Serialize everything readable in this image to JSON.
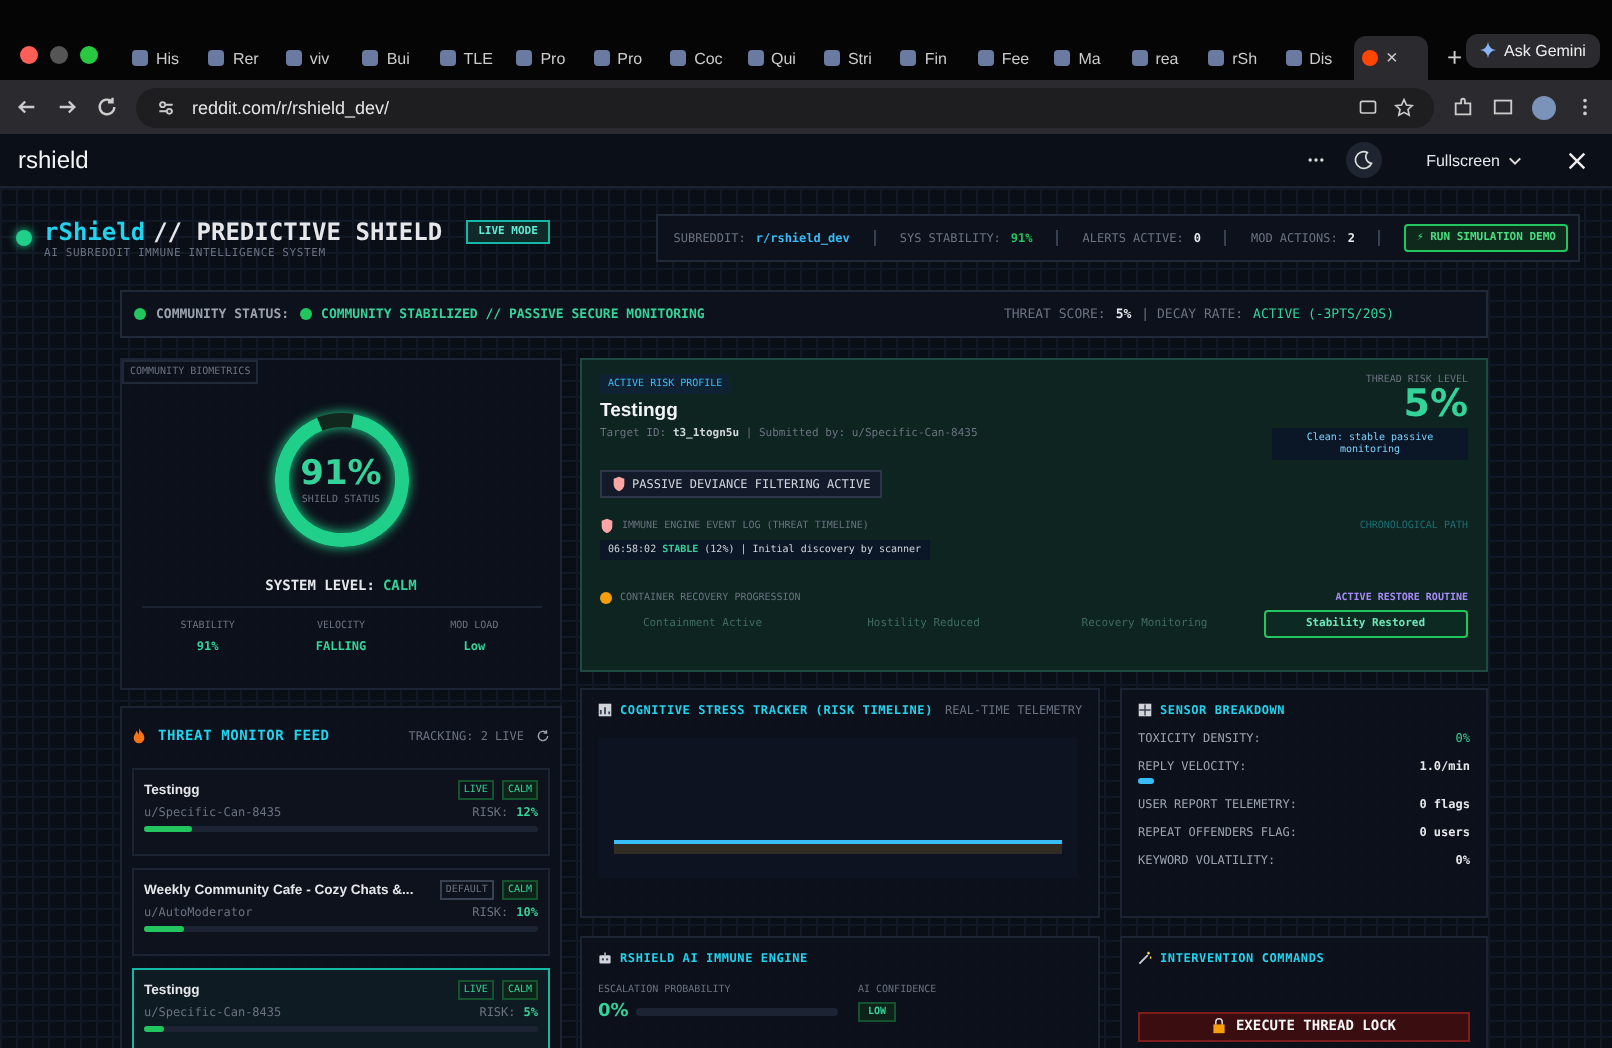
{
  "browser": {
    "tabs": [
      {
        "label": "His",
        "selected": false
      },
      {
        "label": "Rer",
        "selected": false
      },
      {
        "label": "viv",
        "selected": false
      },
      {
        "label": "Bui",
        "selected": false
      },
      {
        "label": "TLE",
        "selected": false
      },
      {
        "label": "Pro",
        "selected": false
      },
      {
        "label": "Pro",
        "selected": false
      },
      {
        "label": "Coc",
        "selected": false
      },
      {
        "label": "Qui",
        "selected": false
      },
      {
        "label": "Stri",
        "selected": false
      },
      {
        "label": "Fin",
        "selected": false
      },
      {
        "label": "Fee",
        "selected": false
      },
      {
        "label": "Ma",
        "selected": false
      },
      {
        "label": "rea",
        "selected": false
      },
      {
        "label": "rSh",
        "selected": false
      },
      {
        "label": "Dis",
        "selected": false
      },
      {
        "close": "×",
        "selected": true
      }
    ],
    "new_tab": "+",
    "gemini": "Ask Gemini",
    "url": "reddit.com/r/rshield_dev/"
  },
  "app_bar": {
    "title": "rshield",
    "fullscreen": "Fullscreen"
  },
  "header": {
    "brand": "rShield",
    "title": "// PREDICTIVE SHIELD",
    "badge": "LIVE MODE",
    "subtitle": "AI SUBREDDIT IMMUNE INTELLIGENCE SYSTEM",
    "stats": [
      {
        "label": "SUBREDDIT:",
        "value": "r/rshield_dev",
        "color": "#38bdf8"
      },
      {
        "label": "SYS STABILITY:",
        "value": "91%",
        "color": "#22c55e"
      },
      {
        "label": "ALERTS ACTIVE:",
        "value": "0",
        "color": "#e5e7eb"
      },
      {
        "label": "MOD ACTIONS:",
        "value": "2",
        "color": "#e5e7eb"
      }
    ],
    "demo_button": "⚡ RUN SIMULATION DEMO"
  },
  "status": {
    "label": "COMMUNITY STATUS:",
    "message": "COMMUNITY STABILIZED // PASSIVE SECURE MONITORING",
    "threat_label": "THREAT SCORE:",
    "threat_value": "5%",
    "decay_label": "| DECAY RATE:",
    "decay_value": "ACTIVE (-3PTS/20S)"
  },
  "biometrics": {
    "label": "COMMUNITY BIOMETRICS",
    "value": "91%",
    "caption": "SHIELD STATUS",
    "level": 0.91,
    "system_label": "SYSTEM LEVEL:",
    "system_value": "CALM",
    "stats": [
      {
        "label": "STABILITY",
        "value": "91%"
      },
      {
        "label": "VELOCITY",
        "value": "FALLING"
      },
      {
        "label": "MOD LOAD",
        "value": "Low"
      }
    ]
  },
  "risk_profile": {
    "label": "ACTIVE RISK PROFILE",
    "title": "Testingg",
    "target": "Target ID: **t3_1togn5u** | Submitted by: u/Specific-Can-8435",
    "risk_label": "THREAD RISK LEVEL",
    "risk_value": "5%",
    "risk_note": "Clean: stable passive monitoring",
    "filter": "PASSIVE DEVIANCE FILTERING ACTIVE",
    "log_title": "IMMUNE ENGINE EVENT LOG (THREAT TIMELINE)",
    "log_path": "CHRONOLOGICAL PATH",
    "events": [
      "06:58:02 **STABLE** (12%) | Initial discovery by scanner"
    ],
    "recovery_title": "CONTAINER RECOVERY PROGRESSION",
    "recovery_note": "ACTIVE RESTORE ROUTINE",
    "stages": [
      {
        "label": "Containment Active",
        "selected": false
      },
      {
        "label": "Hostility Reduced",
        "selected": false
      },
      {
        "label": "Recovery Monitoring",
        "selected": false
      },
      {
        "label": "Stability Restored",
        "selected": true
      }
    ]
  },
  "feed": {
    "title": "THREAT MONITOR FEED",
    "tracking": "TRACKING: 2 LIVE",
    "items": [
      {
        "title": "Testingg",
        "author": "u/Specific-Can-8435",
        "tags": [
          {
            "label": "LIVE",
            "kind": "live"
          },
          {
            "label": "CALM",
            "kind": "calm"
          }
        ],
        "risk_label": "RISK:",
        "risk": "12%",
        "level": 0.12,
        "selected": false
      },
      {
        "title": "Weekly Community Cafe - Cozy Chats &...",
        "author": "u/AutoModerator",
        "tags": [
          {
            "label": "DEFAULT",
            "kind": "default"
          },
          {
            "label": "CALM",
            "kind": "calm"
          }
        ],
        "risk_label": "RISK:",
        "risk": "10%",
        "level": 0.1,
        "selected": false
      },
      {
        "title": "Testingg",
        "author": "u/Specific-Can-8435",
        "tags": [
          {
            "label": "LIVE",
            "kind": "live"
          },
          {
            "label": "CALM",
            "kind": "calm"
          }
        ],
        "risk_label": "RISK:",
        "risk": "5%",
        "level": 0.05,
        "selected": true
      }
    ]
  },
  "stress_tracker": {
    "title": "COGNITIVE STRESS TRACKER (RISK TIMELINE)",
    "subtitle": "REAL-TIME TELEMETRY"
  },
  "sensors": {
    "title": "SENSOR BREAKDOWN",
    "rows": [
      {
        "label": "TOXICITY DENSITY:",
        "value": "0%",
        "kind": "good"
      },
      {
        "label": "REPLY VELOCITY:",
        "value": "1.0/min",
        "kind": "bar",
        "level": 0.05
      },
      {
        "label": "USER REPORT TELEMETRY:",
        "value": "0 flags",
        "kind": "plain"
      },
      {
        "label": "REPEAT OFFENDERS FLAG:",
        "value": "0 users",
        "kind": "plain"
      },
      {
        "label": "KEYWORD VOLATILITY:",
        "value": "0%",
        "kind": "plain"
      }
    ]
  },
  "engine": {
    "title": "RSHIELD AI IMMUNE ENGINE",
    "escalation_label": "ESCALATION PROBABILITY",
    "escalation_value": "0%",
    "confidence_label": "AI CONFIDENCE",
    "confidence": "LOW"
  },
  "commands": {
    "title": "INTERVENTION COMMANDS",
    "button": "EXECUTE THREAD LOCK"
  }
}
